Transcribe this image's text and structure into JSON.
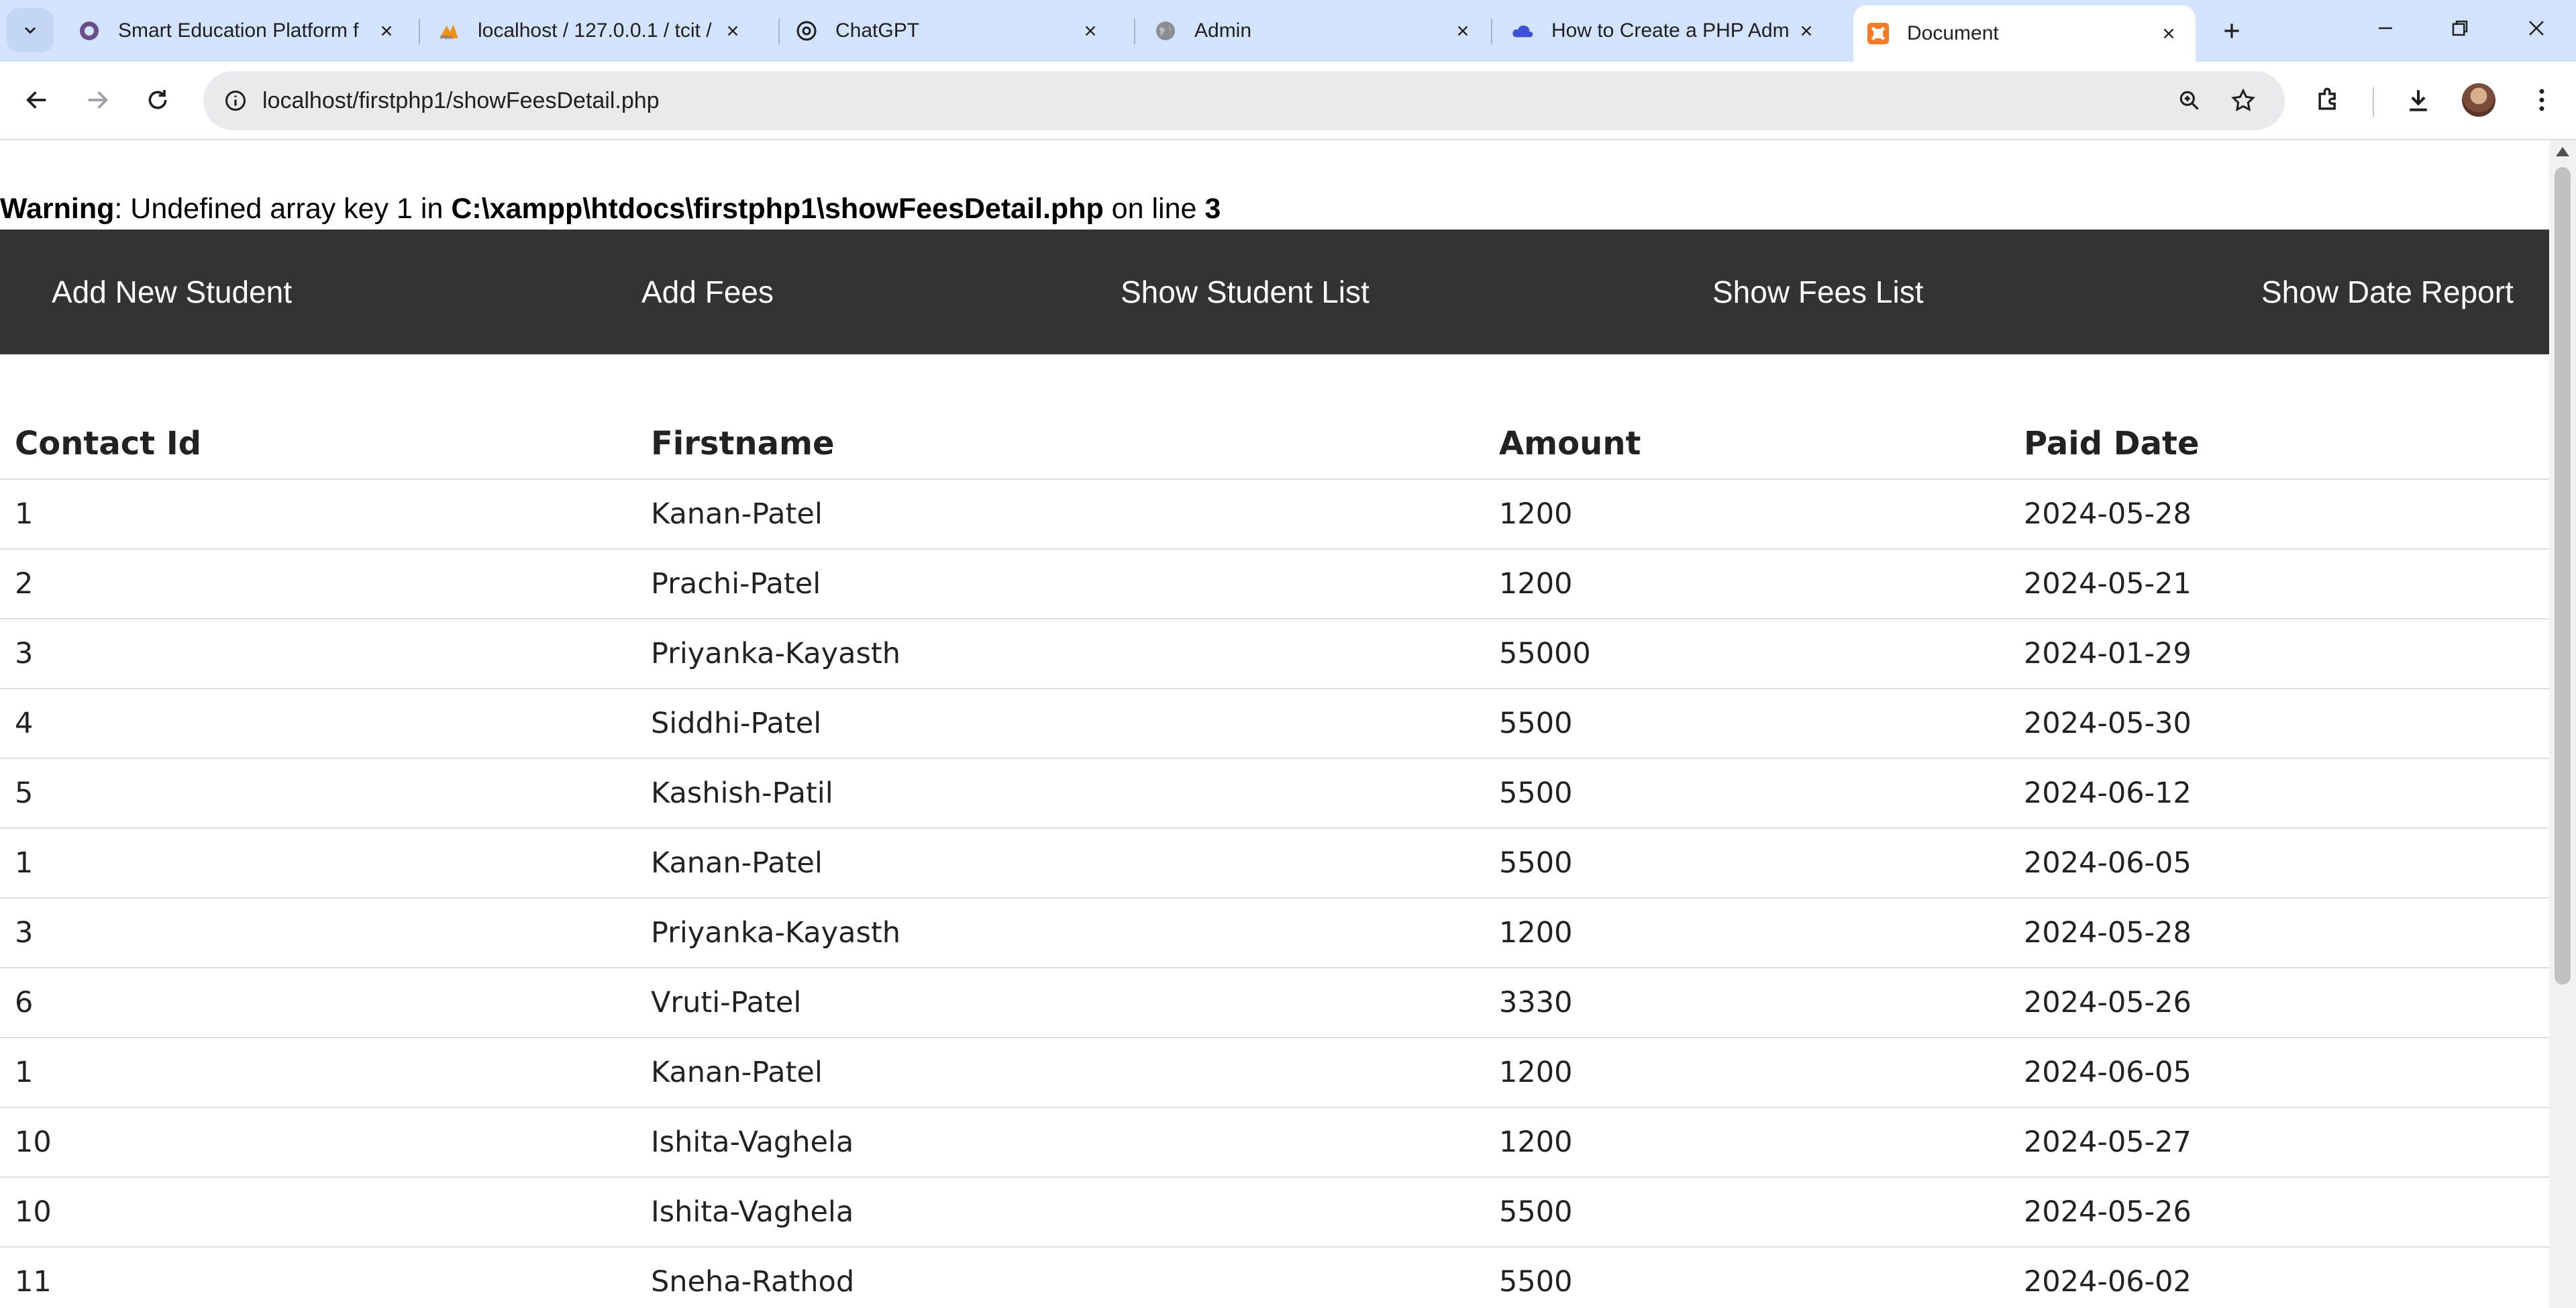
{
  "browser": {
    "tabs": [
      {
        "title": "Smart Education Platform f",
        "icon": "circle-logo-icon",
        "active": false
      },
      {
        "title": "localhost / 127.0.0.1 / tcit /",
        "icon": "phpmyadmin-icon",
        "active": false
      },
      {
        "title": "ChatGPT",
        "icon": "chatgpt-icon",
        "active": false
      },
      {
        "title": "Admin",
        "icon": "globe-icon",
        "active": false
      },
      {
        "title": "How to Create a PHP Adm",
        "icon": "cloud-icon",
        "active": false
      },
      {
        "title": "Document",
        "icon": "xampp-icon",
        "active": true
      }
    ],
    "url": "localhost/firstphp1/showFeesDetail.php"
  },
  "page": {
    "warning": {
      "label": "Warning",
      "message": ": Undefined array key 1 in ",
      "file": "C:\\xampp\\htdocs\\firstphp1\\showFeesDetail.php",
      "line_text": " on line ",
      "line_number": "3"
    },
    "nav": {
      "add_student": "Add New Student",
      "add_fees": "Add Fees",
      "show_student_list": "Show Student List",
      "show_fees_list": "Show Fees List",
      "show_date_report": "Show Date Report"
    },
    "table": {
      "headers": [
        "Contact Id",
        "Firstname",
        "Amount",
        "Paid Date"
      ],
      "rows": [
        [
          "1",
          "Kanan-Patel",
          "1200",
          "2024-05-28"
        ],
        [
          "2",
          "Prachi-Patel",
          "1200",
          "2024-05-21"
        ],
        [
          "3",
          "Priyanka-Kayasth",
          "55000",
          "2024-01-29"
        ],
        [
          "4",
          "Siddhi-Patel",
          "5500",
          "2024-05-30"
        ],
        [
          "5",
          "Kashish-Patil",
          "5500",
          "2024-06-12"
        ],
        [
          "1",
          "Kanan-Patel",
          "5500",
          "2024-06-05"
        ],
        [
          "3",
          "Priyanka-Kayasth",
          "1200",
          "2024-05-28"
        ],
        [
          "6",
          "Vruti-Patel",
          "3330",
          "2024-05-26"
        ],
        [
          "1",
          "Kanan-Patel",
          "1200",
          "2024-06-05"
        ],
        [
          "10",
          "Ishita-Vaghela",
          "1200",
          "2024-05-27"
        ],
        [
          "10",
          "Ishita-Vaghela",
          "5500",
          "2024-05-26"
        ],
        [
          "11",
          "Sneha-Rathod",
          "5500",
          "2024-06-02"
        ]
      ]
    }
  },
  "colors": {
    "tab_strip": "#d3e3fd",
    "navbar": "#333333",
    "nav_text": "#ffffff"
  }
}
